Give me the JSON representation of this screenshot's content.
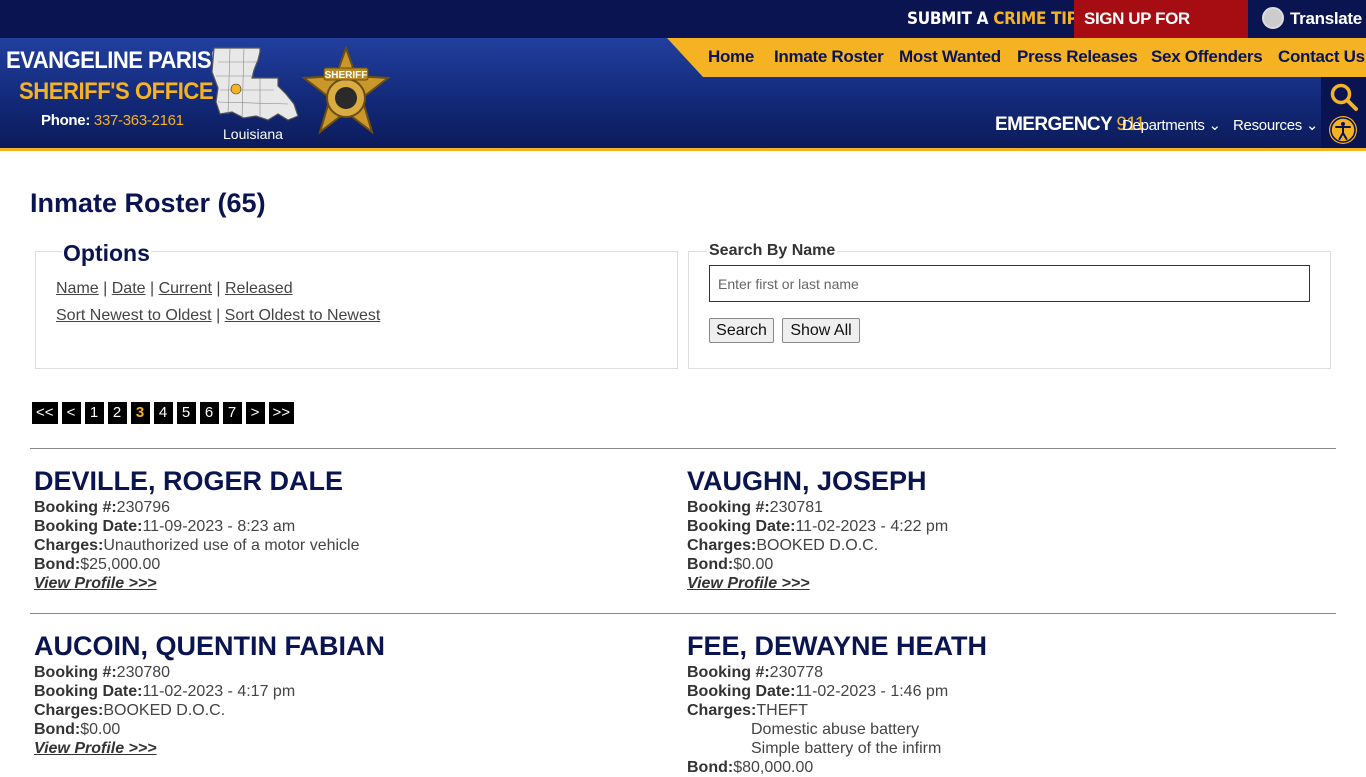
{
  "topbar": {
    "tip_prefix": "SUBMIT A",
    "tip_highlight": "CRIME TIP",
    "alerts_label": "SIGN UP FOR ALERTS",
    "translate_label": "Translate"
  },
  "logo": {
    "name": "EVANGELINE PARISH",
    "office": "SHERIFF'S OFFICE",
    "phone_label": "Phone:",
    "phone": "337-363-2161",
    "state": "Louisiana"
  },
  "nav": {
    "items": [
      "Home",
      "Inmate Roster",
      "Most Wanted",
      "Press Releases",
      "Sex Offenders",
      "Contact Us"
    ]
  },
  "subnav": {
    "emergency_label": "EMERGENCY",
    "emergency_number": "911",
    "departments": "Departments",
    "resources": "Resources"
  },
  "page": {
    "title": "Inmate Roster (65)"
  },
  "options": {
    "legend": "Options",
    "filters": [
      "Name",
      "Date",
      "Current",
      "Released"
    ],
    "sorts": [
      "Sort Newest to Oldest",
      "Sort Oldest to Newest"
    ]
  },
  "search": {
    "legend": "Search By Name",
    "placeholder": "Enter first or last name",
    "search_button": "Search",
    "show_all_button": "Show All"
  },
  "pager": {
    "items": [
      "<<",
      "<",
      "1",
      "2",
      "3",
      "4",
      "5",
      "6",
      "7",
      ">",
      ">>"
    ],
    "active": "3"
  },
  "labels": {
    "booking_no": "Booking #:",
    "booking_date": "Booking Date:",
    "charges": "Charges:",
    "bond": "Bond:",
    "view_profile": "View Profile >>>"
  },
  "inmates": [
    {
      "name": "DEVILLE, ROGER DALE",
      "booking": "230796",
      "date": "11-09-2023 - 8:23 am",
      "charges": "Unauthorized use of a motor vehicle",
      "bond": "$25,000.00"
    },
    {
      "name": "VAUGHN, JOSEPH",
      "booking": "230781",
      "date": "11-02-2023 - 4:22 pm",
      "charges": "BOOKED D.O.C.",
      "bond": "$0.00"
    },
    {
      "name": "AUCOIN, QUENTIN FABIAN",
      "booking": "230780",
      "date": "11-02-2023 - 4:17 pm",
      "charges": "BOOKED D.O.C.",
      "bond": "$0.00"
    },
    {
      "name": "FEE, DEWAYNE HEATH",
      "booking": "230778",
      "date": "11-02-2023 - 1:46 pm",
      "charges": "THEFT",
      "extra_charges": [
        "Domestic abuse battery",
        "Simple battery of the infirm"
      ],
      "bond": "$80,000.00"
    }
  ]
}
